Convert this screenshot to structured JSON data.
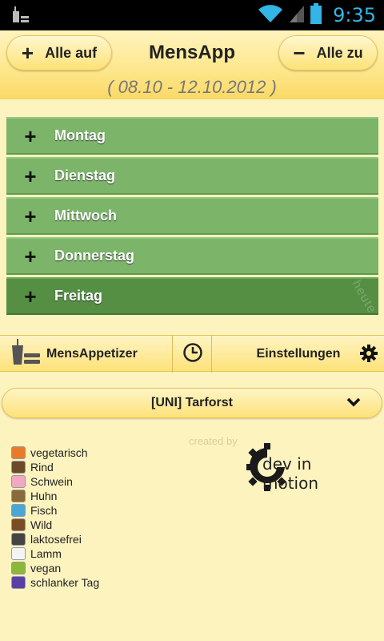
{
  "status_bar": {
    "time": "9:35"
  },
  "header": {
    "expand_all": "Alle auf",
    "collapse_all": "Alle zu",
    "title": "MensApp",
    "date_range": "( 08.10 - 12.10.2012 )"
  },
  "days": [
    {
      "label": "Montag"
    },
    {
      "label": "Dienstag"
    },
    {
      "label": "Mittwoch"
    },
    {
      "label": "Donnerstag"
    },
    {
      "label": "Freitag",
      "tag": "heute"
    }
  ],
  "toolbar": {
    "menu_label": "MensAppetizer",
    "settings_label": "Einstellungen"
  },
  "canteen": {
    "selected": "[UNI] Tarforst"
  },
  "footer": {
    "created_by": "created by",
    "brand": "dev in motion"
  },
  "legend": [
    {
      "icon": "carrot-icon",
      "color": "#e87a2b",
      "label": "vegetarisch"
    },
    {
      "icon": "cow-icon",
      "color": "#6b4a2b",
      "label": "Rind"
    },
    {
      "icon": "pig-icon",
      "color": "#f2a7c3",
      "label": "Schwein"
    },
    {
      "icon": "chicken-icon",
      "color": "#8a6a3a",
      "label": "Huhn"
    },
    {
      "icon": "fish-icon",
      "color": "#4aa6d6",
      "label": "Fisch"
    },
    {
      "icon": "deer-icon",
      "color": "#7a4e25",
      "label": "Wild"
    },
    {
      "icon": "lactose-free-icon",
      "color": "#444444",
      "label": "laktosefrei"
    },
    {
      "icon": "lamb-icon",
      "color": "#f4f4f4",
      "label": "Lamm"
    },
    {
      "icon": "vegan-icon",
      "color": "#8ab83a",
      "label": "vegan"
    },
    {
      "icon": "slim-day-icon",
      "color": "#5a3fa8",
      "label": "schlanker Tag"
    }
  ]
}
